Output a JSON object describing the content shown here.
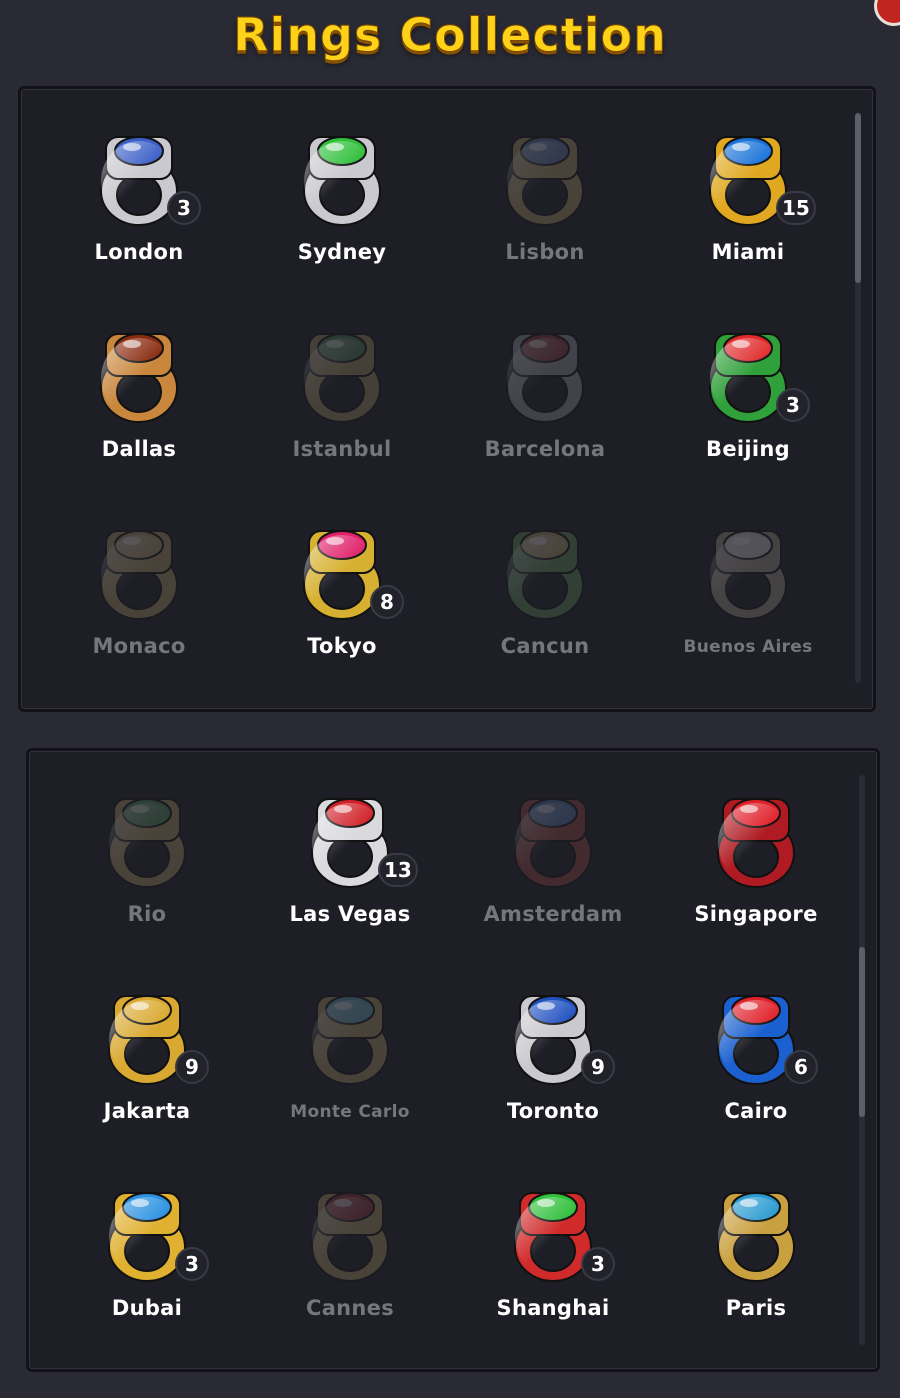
{
  "title": "Rings Collection",
  "colors": {
    "title": "#ffd21a",
    "panel": "#1e1e27",
    "background": "#2a2a35",
    "locked_label": "#76767e",
    "unlocked_label": "#ffffff"
  },
  "panels": [
    {
      "rings": [
        {
          "name": "London",
          "count": "3",
          "unlocked": true,
          "gem": "#3a5fc7",
          "metal": "#c9c9cf"
        },
        {
          "name": "Sydney",
          "count": "",
          "unlocked": true,
          "gem": "#2fbf3a",
          "metal": "#c9c9cf"
        },
        {
          "name": "Lisbon",
          "count": "",
          "unlocked": false,
          "gem": "#4a7bd0",
          "metal": "#c9a040"
        },
        {
          "name": "Miami",
          "count": "15",
          "unlocked": true,
          "gem": "#1a73d9",
          "metal": "#e0a820"
        },
        {
          "name": "Dallas",
          "count": "",
          "unlocked": true,
          "gem": "#8a2b10",
          "metal": "#c9873e"
        },
        {
          "name": "Istanbul",
          "count": "",
          "unlocked": false,
          "gem": "#2f8a3a",
          "metal": "#b89a3a"
        },
        {
          "name": "Barcelona",
          "count": "",
          "unlocked": false,
          "gem": "#c0282a",
          "metal": "#a0a0a8"
        },
        {
          "name": "Beijing",
          "count": "3",
          "unlocked": true,
          "gem": "#e02a2a",
          "metal": "#2fa03a"
        },
        {
          "name": "Monaco",
          "count": "",
          "unlocked": false,
          "gem": "#c9a040",
          "metal": "#c9a040"
        },
        {
          "name": "Tokyo",
          "count": "8",
          "unlocked": true,
          "gem": "#e0206a",
          "metal": "#d6b030"
        },
        {
          "name": "Cancun",
          "count": "",
          "unlocked": false,
          "gem": "#c9a040",
          "metal": "#4aa040"
        },
        {
          "name": "Buenos Aires",
          "count": "",
          "unlocked": false,
          "gem": "#d0d0d0",
          "metal": "#b0a080"
        }
      ]
    },
    {
      "rings": [
        {
          "name": "Rio",
          "count": "",
          "unlocked": false,
          "gem": "#2fa040",
          "metal": "#c9a040"
        },
        {
          "name": "Las Vegas",
          "count": "13",
          "unlocked": true,
          "gem": "#d02028",
          "metal": "#d9d9de"
        },
        {
          "name": "Amsterdam",
          "count": "",
          "unlocked": false,
          "gem": "#3a7ad0",
          "metal": "#d04030"
        },
        {
          "name": "Singapore",
          "count": "",
          "unlocked": true,
          "gem": "#e0202a",
          "metal": "#b01a22"
        },
        {
          "name": "Jakarta",
          "count": "9",
          "unlocked": true,
          "gem": "#d9a830",
          "metal": "#d9a830"
        },
        {
          "name": "Monte Carlo",
          "count": "",
          "unlocked": false,
          "gem": "#3ab0d0",
          "metal": "#c9a040"
        },
        {
          "name": "Toronto",
          "count": "9",
          "unlocked": true,
          "gem": "#2050c0",
          "metal": "#c9c9cf"
        },
        {
          "name": "Cairo",
          "count": "6",
          "unlocked": true,
          "gem": "#e0202a",
          "metal": "#1a60d0"
        },
        {
          "name": "Dubai",
          "count": "3",
          "unlocked": true,
          "gem": "#2a90e0",
          "metal": "#e0b030"
        },
        {
          "name": "Cannes",
          "count": "",
          "unlocked": false,
          "gem": "#d02028",
          "metal": "#c9a040"
        },
        {
          "name": "Shanghai",
          "count": "3",
          "unlocked": true,
          "gem": "#2fbf3a",
          "metal": "#d02a2a"
        },
        {
          "name": "Paris",
          "count": "",
          "unlocked": true,
          "gem": "#2a9ad0",
          "metal": "#c9a040"
        }
      ]
    }
  ]
}
